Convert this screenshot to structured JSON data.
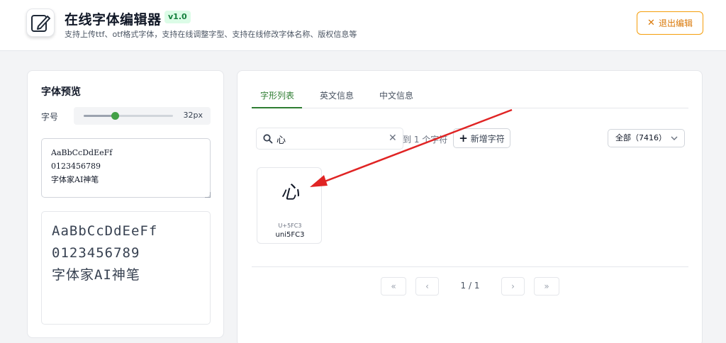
{
  "header": {
    "title": "在线字体编辑器",
    "version": "v1.0",
    "subtitle": "支持上传ttf、otf格式字体，支持在线调整字型、支持在线修改字体名称、版权信息等",
    "exit_label": "退出编辑",
    "exit_icon": "x-icon"
  },
  "preview": {
    "title": "字体预览",
    "size_label": "字号",
    "size_value": "32px",
    "size_fraction": 0.35,
    "sample_text": "AaBbCcDdEeFf\n0123456789\n字体家AI神笔",
    "rendered_text": "AaBbCcDdEeFf\n0123456789\n字体家AI神笔"
  },
  "tabs": [
    {
      "label": "字形列表",
      "active": true
    },
    {
      "label": "英文信息",
      "active": false
    },
    {
      "label": "中文信息",
      "active": false
    }
  ],
  "search": {
    "value": "心",
    "clear_icon": "close-icon",
    "result_text": "到 1 个字符"
  },
  "add_button": {
    "label": "新增字符"
  },
  "filter": {
    "value": "全部（7416）"
  },
  "glyphs": [
    {
      "char": "心",
      "code": "U+5FC3",
      "name": "uni5FC3"
    }
  ],
  "pagination": {
    "first": "«",
    "prev": "‹",
    "info": "1 / 1",
    "next": "›",
    "last": "»"
  },
  "colors": {
    "accent": "#2e7d32",
    "warning": "#d97706",
    "annotation": "#e02424"
  }
}
